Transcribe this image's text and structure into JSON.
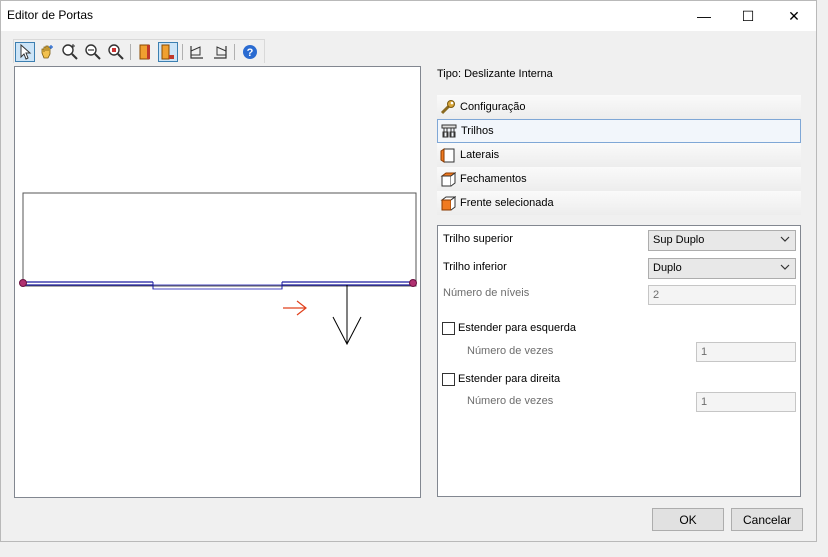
{
  "window": {
    "title": "Editor de Portas",
    "controls": {
      "minimize": "—",
      "maximize": "☐",
      "close": "✕"
    }
  },
  "toolbar": {
    "icons": [
      "select-arrow-icon",
      "pan-hand-icon",
      "zoom-in-icon",
      "zoom-out-icon",
      "zoom-fit-icon",
      "door-left-icon",
      "door-corner-icon",
      "panel-front-icon",
      "panel-side-icon",
      "help-icon"
    ]
  },
  "info": {
    "tipo": "Tipo: Deslizante Interna"
  },
  "sections": [
    {
      "label": "Configuração",
      "icon": "wrench-icon"
    },
    {
      "label": "Trilhos",
      "icon": "rails-icon",
      "selected": true
    },
    {
      "label": "Laterais",
      "icon": "laterals-icon"
    },
    {
      "label": "Fechamentos",
      "icon": "closures-icon"
    },
    {
      "label": "Frente selecionada",
      "icon": "front-icon"
    }
  ],
  "form": {
    "trilho_superior_label": "Trilho superior",
    "trilho_superior_value": "Sup Duplo",
    "trilho_inferior_label": "Trilho inferior",
    "trilho_inferior_value": "Duplo",
    "numero_niveis_label": "Número de níveis",
    "numero_niveis_value": "2",
    "estender_esquerda_label": "Estender para esquerda",
    "numero_vezes_esq_label": "Número de vezes",
    "numero_vezes_esq_value": "1",
    "estender_direita_label": "Estender para direita",
    "numero_vezes_dir_label": "Número de vezes",
    "numero_vezes_dir_value": "1"
  },
  "footer": {
    "ok": "OK",
    "cancel": "Cancelar"
  },
  "colors": {
    "accent": "#3c7fb1",
    "arrow_red": "#e0401c",
    "rail": "#1a1aa0"
  }
}
